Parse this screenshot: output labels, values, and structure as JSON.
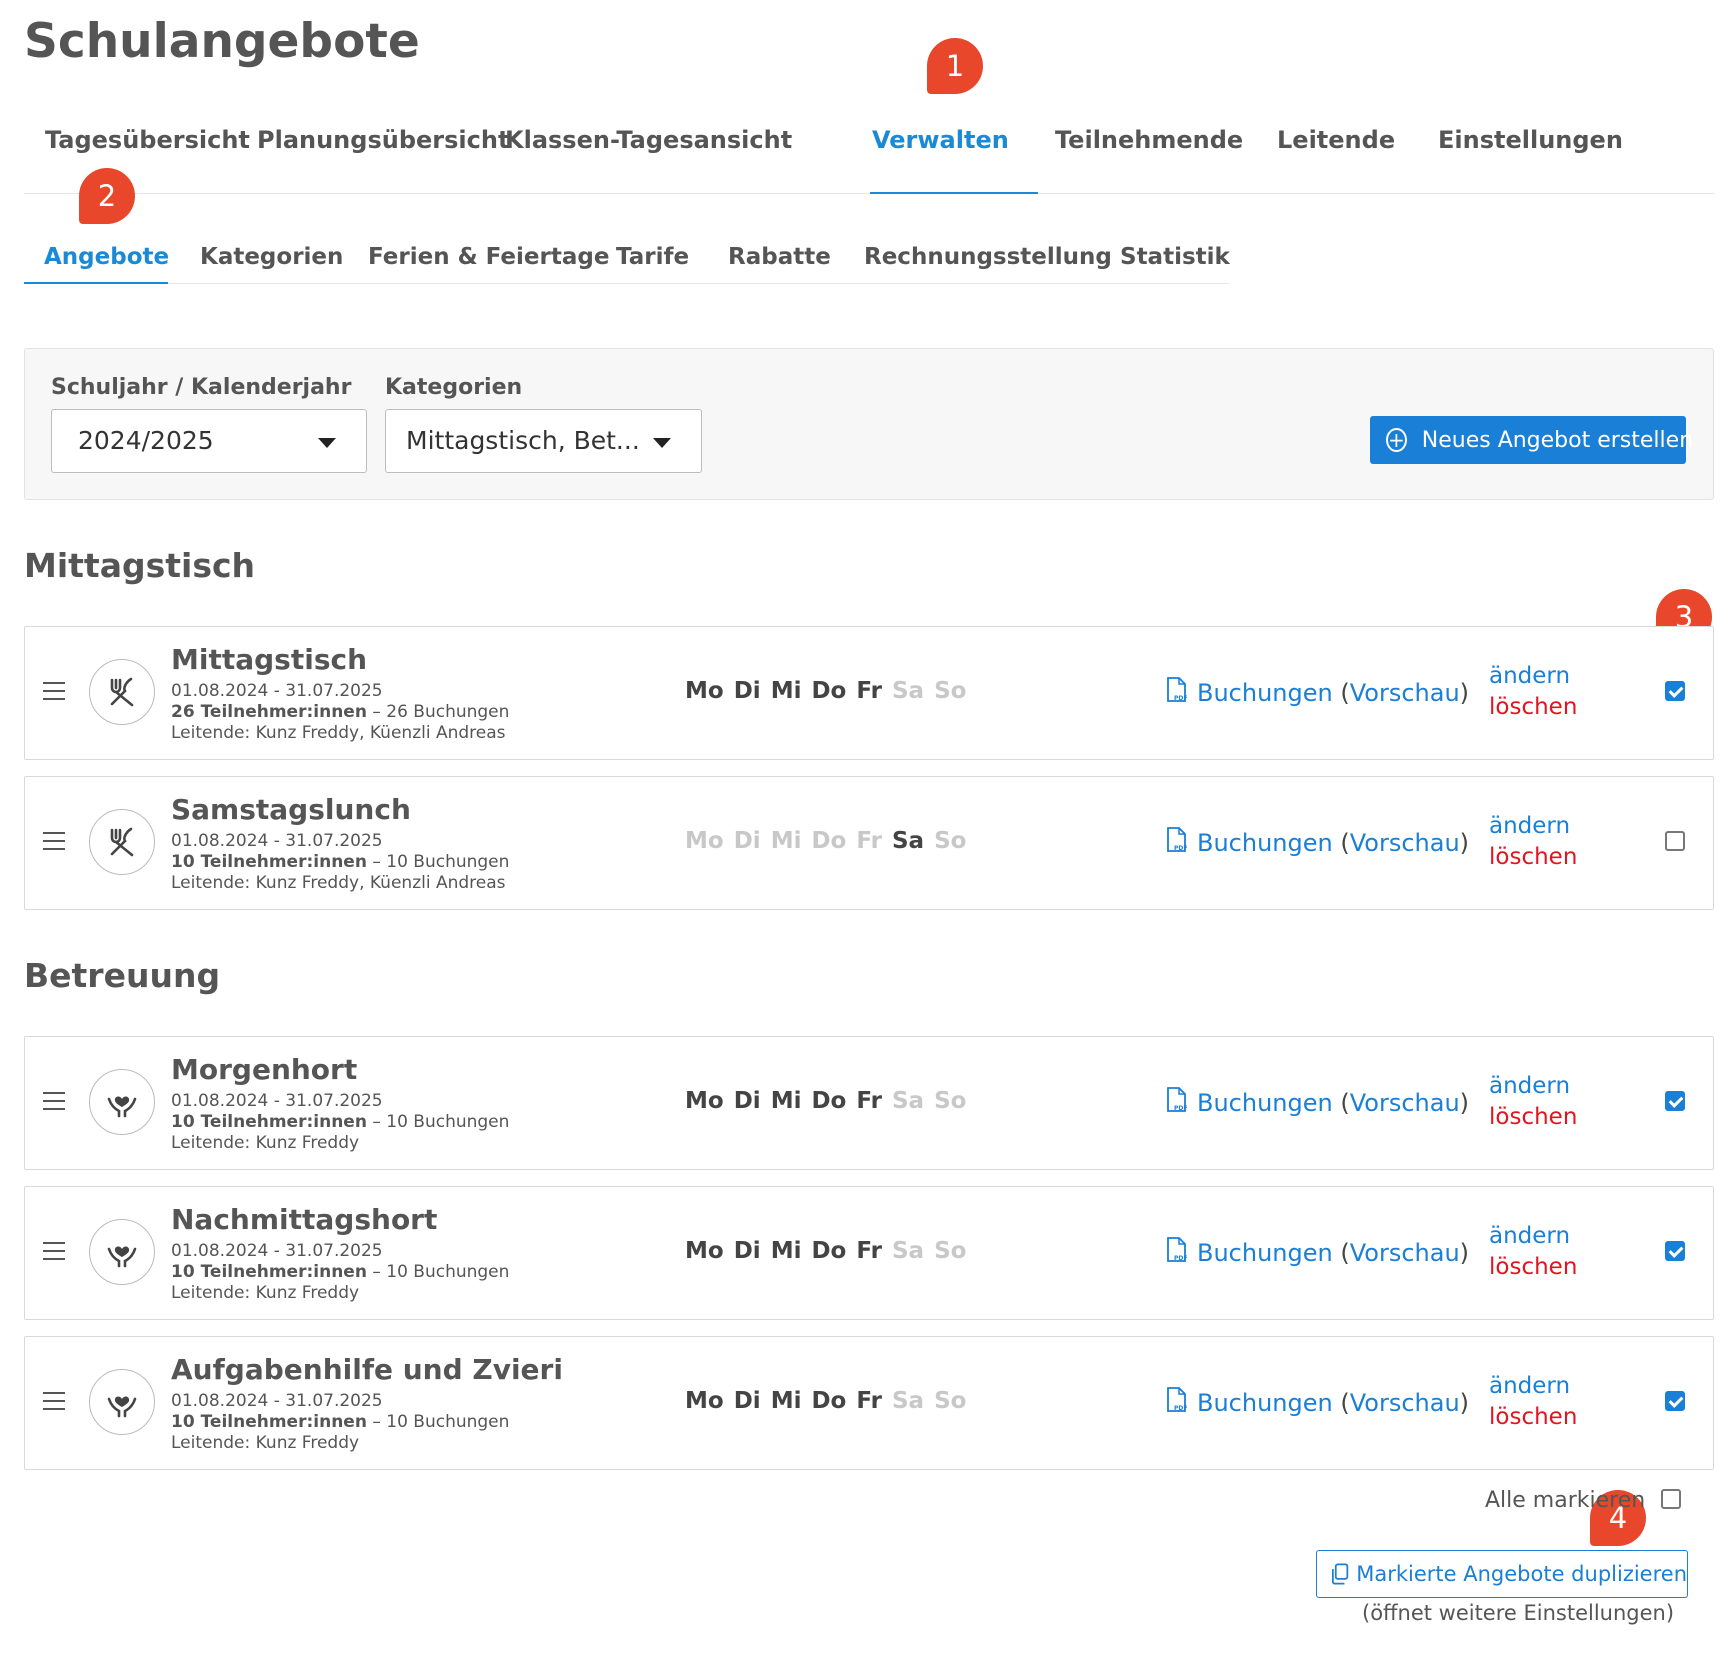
{
  "page_title": "Schulangebote",
  "main_tabs": [
    {
      "label": "Tagesübersicht"
    },
    {
      "label": "Planungsübersicht"
    },
    {
      "label": "Klassen-Tagesansicht"
    },
    {
      "label": "Verwalten",
      "active": true
    },
    {
      "label": "Teilnehmende"
    },
    {
      "label": "Leitende"
    },
    {
      "label": "Einstellungen"
    }
  ],
  "sub_tabs": [
    {
      "label": "Angebote",
      "active": true
    },
    {
      "label": "Kategorien"
    },
    {
      "label": "Ferien & Feiertage"
    },
    {
      "label": "Tarife"
    },
    {
      "label": "Rabatte"
    },
    {
      "label": "Rechnungsstellung"
    },
    {
      "label": "Statistik"
    }
  ],
  "markers": [
    "1",
    "2",
    "3",
    "4"
  ],
  "filters": {
    "year_label": "Schuljahr / Kalenderjahr",
    "year_value": "2024/2025",
    "category_label": "Kategorien",
    "category_value": "Mittagstisch, Bet..."
  },
  "new_offer_button": "Neues Angebot erstellen",
  "common": {
    "bookings_label": "Buchungen",
    "paren_open": "(",
    "preview_label": "Vorschau",
    "paren_close": ")",
    "edit_label": "ändern",
    "delete_label": "löschen"
  },
  "sections": [
    {
      "title": "Mittagstisch",
      "offers": [
        {
          "name": "Mittagstisch",
          "date": "01.08.2024 - 31.07.2025",
          "participants": "26 Teilnehmer:innen",
          "bookings": "– 26 Buchungen",
          "lead": "Leitende: Kunz Freddy, Küenzli Andreas",
          "icon": "cutlery-icon",
          "days": [
            {
              "label": "Mo",
              "active": true
            },
            {
              "label": "Di",
              "active": true
            },
            {
              "label": "Mi",
              "active": true
            },
            {
              "label": "Do",
              "active": true
            },
            {
              "label": "Fr",
              "active": true
            },
            {
              "label": "Sa",
              "active": false
            },
            {
              "label": "So",
              "active": false
            }
          ],
          "checked": true
        },
        {
          "name": "Samstagslunch",
          "date": "01.08.2024 - 31.07.2025",
          "participants": "10 Teilnehmer:innen",
          "bookings": "– 10 Buchungen",
          "lead": "Leitende: Kunz Freddy, Küenzli Andreas",
          "icon": "cutlery-icon",
          "days": [
            {
              "label": "Mo",
              "active": false
            },
            {
              "label": "Di",
              "active": false
            },
            {
              "label": "Mi",
              "active": false
            },
            {
              "label": "Do",
              "active": false
            },
            {
              "label": "Fr",
              "active": false
            },
            {
              "label": "Sa",
              "active": true
            },
            {
              "label": "So",
              "active": false
            }
          ],
          "checked": false
        }
      ]
    },
    {
      "title": "Betreuung",
      "offers": [
        {
          "name": "Morgenhort",
          "date": "01.08.2024 - 31.07.2025",
          "participants": "10 Teilnehmer:innen",
          "bookings": "– 10 Buchungen",
          "lead": "Leitende: Kunz Freddy",
          "icon": "care-hands-heart-icon",
          "days": [
            {
              "label": "Mo",
              "active": true
            },
            {
              "label": "Di",
              "active": true
            },
            {
              "label": "Mi",
              "active": true
            },
            {
              "label": "Do",
              "active": true
            },
            {
              "label": "Fr",
              "active": true
            },
            {
              "label": "Sa",
              "active": false
            },
            {
              "label": "So",
              "active": false
            }
          ],
          "checked": true
        },
        {
          "name": "Nachmittagshort",
          "date": "01.08.2024 - 31.07.2025",
          "participants": "10 Teilnehmer:innen",
          "bookings": "– 10 Buchungen",
          "lead": "Leitende: Kunz Freddy",
          "icon": "care-hands-heart-icon",
          "days": [
            {
              "label": "Mo",
              "active": true
            },
            {
              "label": "Di",
              "active": true
            },
            {
              "label": "Mi",
              "active": true
            },
            {
              "label": "Do",
              "active": true
            },
            {
              "label": "Fr",
              "active": true
            },
            {
              "label": "Sa",
              "active": false
            },
            {
              "label": "So",
              "active": false
            }
          ],
          "checked": true
        },
        {
          "name": "Aufgabenhilfe und Zvieri",
          "date": "01.08.2024 - 31.07.2025",
          "participants": "10 Teilnehmer:innen",
          "bookings": "– 10 Buchungen",
          "lead": "Leitende: Kunz Freddy",
          "icon": "care-hands-heart-icon",
          "days": [
            {
              "label": "Mo",
              "active": true
            },
            {
              "label": "Di",
              "active": true
            },
            {
              "label": "Mi",
              "active": true
            },
            {
              "label": "Do",
              "active": true
            },
            {
              "label": "Fr",
              "active": true
            },
            {
              "label": "Sa",
              "active": false
            },
            {
              "label": "So",
              "active": false
            }
          ],
          "checked": true
        }
      ]
    }
  ],
  "mark_all_label": "Alle markieren",
  "mark_all_checked": false,
  "duplicate_button": "Markierte Angebote duplizieren",
  "duplicate_note": "(öffnet weitere Einstellungen)",
  "colors": {
    "accent": "#1a7fd6",
    "danger": "#e4141e",
    "marker": "#e8472c"
  }
}
